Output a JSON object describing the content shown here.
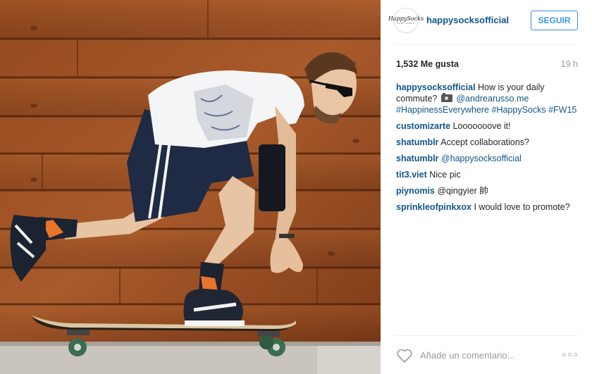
{
  "header": {
    "username": "happysocksofficial",
    "follow_label": "SEGUIR",
    "avatar_logo": "HappySocks",
    "avatar_sub": "HAPPY SOCKS"
  },
  "stats": {
    "likes": "1,532 Me gusta",
    "time": "19 h"
  },
  "caption": {
    "user": "happysocksofficial",
    "text": "How is your daily commute?",
    "camera_icon": "camera-icon",
    "mention": "@andrearusso.me",
    "hashtags": "#HappinessEverywhere #HappySocks #FW15"
  },
  "comments": [
    {
      "user": "customizarte",
      "text": "Looooooove it!"
    },
    {
      "user": "shatumblr",
      "text": "Accept collaborations?"
    },
    {
      "user": "shatumblr",
      "text": "@happysocksofficial"
    },
    {
      "user": "tit3.viet",
      "text": "Nice pic"
    },
    {
      "user": "piynomis",
      "text": "@qingyier 帥"
    },
    {
      "user": "sprinkleofpinkxox",
      "text": "I would love to promote?"
    }
  ],
  "footer": {
    "comment_placeholder": "Añade un comentario...",
    "heart_icon": "heart-icon",
    "more_icon": "more-options-icon"
  },
  "colors": {
    "link": "#125688",
    "button": "#3897f0",
    "wood": "#8a4522"
  }
}
